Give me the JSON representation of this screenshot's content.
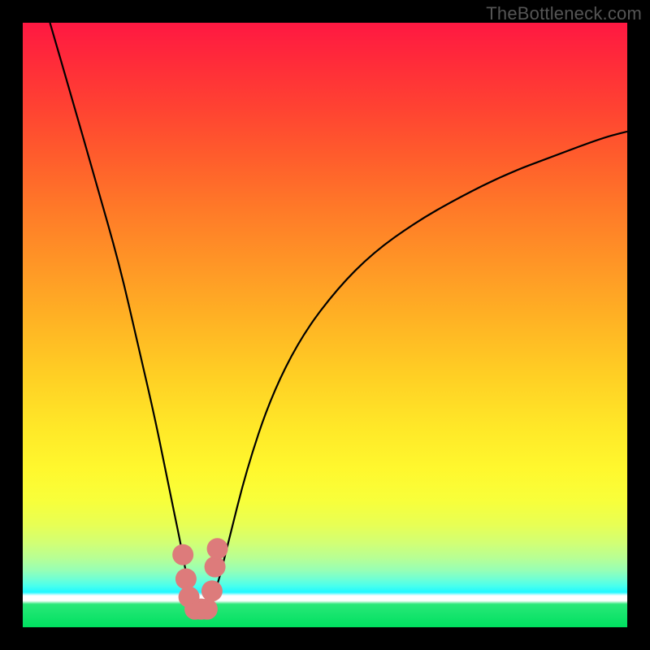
{
  "watermark": "TheBottleneck.com",
  "chart_data": {
    "type": "line",
    "title": "",
    "subtitle": "",
    "xlabel": "",
    "ylabel": "",
    "xlim": [
      0,
      100
    ],
    "ylim": [
      0,
      100
    ],
    "grid": false,
    "legend": false,
    "series": [
      {
        "name": "bottleneck-curve",
        "color": "#000000",
        "x": [
          4.5,
          8,
          12,
          16,
          19,
          22,
          24,
          26.5,
          27.5,
          28.8,
          30.2,
          32,
          34,
          37,
          41,
          46,
          52,
          58,
          65,
          72,
          80,
          88,
          96,
          100
        ],
        "y": [
          100,
          88,
          74,
          60,
          47,
          34,
          24,
          12,
          6,
          3,
          3,
          6,
          14,
          26,
          38,
          48,
          56,
          62,
          67,
          71,
          75,
          78,
          81,
          82
        ]
      },
      {
        "name": "markers",
        "color": "#dd7b7b",
        "type": "scatter",
        "x": [
          26.5,
          27.0,
          27.5,
          28.5,
          29.5,
          30.5,
          31.3,
          31.8,
          32.2
        ],
        "y": [
          12,
          8,
          5,
          3,
          3,
          3,
          6,
          10,
          13
        ]
      }
    ],
    "annotations": []
  }
}
